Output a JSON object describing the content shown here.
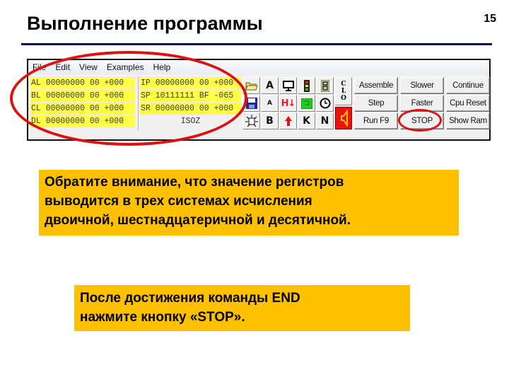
{
  "slide": {
    "title": "Выполнение программы",
    "number": "15"
  },
  "app": {
    "menu": [
      "File",
      "Edit",
      "View",
      "Examples",
      "Help"
    ],
    "registers_left": [
      "AL 00000000 00 +000",
      "BL 00000000 00 +000",
      "CL 00000000 00 +000",
      "DL 00000000 00 +000"
    ],
    "registers_right": [
      "IP 00000000 00 +000",
      "SP 10111111 BF -065",
      "SR 00000000 00 +000"
    ],
    "flags": "ISOZ",
    "icon_buttons": [
      {
        "name": "open-folder-icon",
        "glyph": "📂"
      },
      {
        "name": "font-a-large-icon",
        "glyph": "A"
      },
      {
        "name": "monitor-icon",
        "glyph": "🖵"
      },
      {
        "name": "traffic-light-icon",
        "glyph": ""
      },
      {
        "name": "seven-segment-icon",
        "glyph": "8"
      },
      {
        "name": "save-disk-icon",
        "glyph": "💾"
      },
      {
        "name": "font-a-small-icon",
        "glyph": "A"
      },
      {
        "name": "heater-icon",
        "glyph": "H↓"
      },
      {
        "name": "green-display-icon",
        "glyph": ""
      },
      {
        "name": "clock-icon",
        "glyph": "◷"
      },
      {
        "name": "chip-icon",
        "glyph": "⊡"
      },
      {
        "name": "letter-b-icon",
        "glyph": "B"
      },
      {
        "name": "red-arrow-up-icon",
        "glyph": "▲"
      },
      {
        "name": "letter-k-icon",
        "glyph": "K"
      },
      {
        "name": "letter-n-icon",
        "glyph": "N"
      }
    ],
    "clo_label": [
      "C",
      "L",
      "O"
    ],
    "commands": [
      "Assemble",
      "Slower",
      "Continue",
      "Step",
      "Faster",
      "Cpu Reset",
      "Run F9",
      "STOP",
      "Show Ram"
    ]
  },
  "notes": {
    "first": [
      "Обратите внимание, что значение регистров",
      "выводится в трех системах исчисления",
      "двоичной, шестнадцатеричной и десятичной."
    ],
    "second": [
      "После достижения команды END",
      "нажмите кнопку «STOP»."
    ]
  },
  "colors": {
    "note_bg": "#ffc000",
    "register_bg": "#ffff44",
    "highlight": "#dd1111",
    "rule": "#000066"
  }
}
